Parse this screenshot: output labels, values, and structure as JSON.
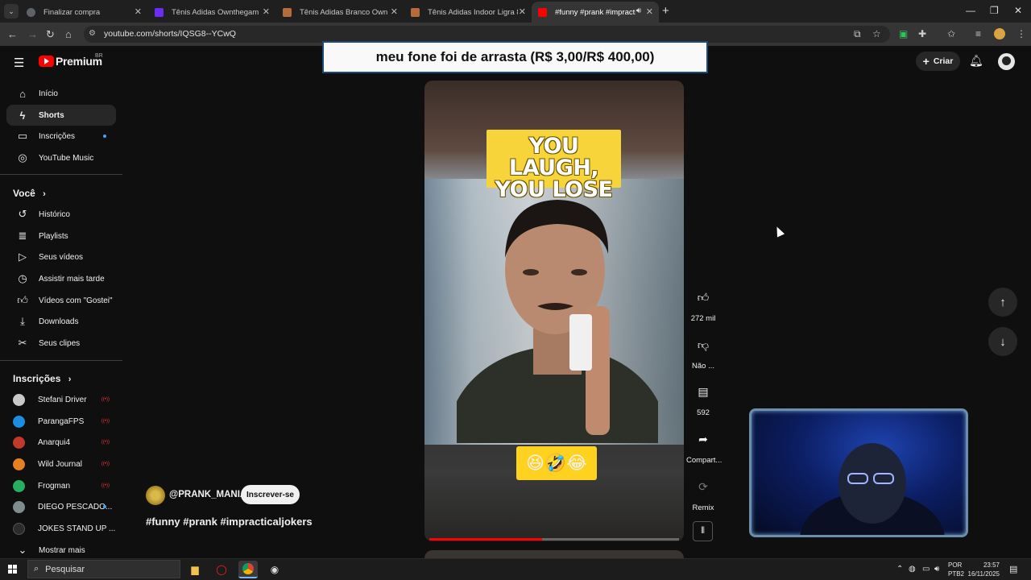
{
  "browser": {
    "tabs": [
      {
        "title": "Finalizar compra",
        "favicon_color": "#5f6368"
      },
      {
        "title": "Tênis Adidas Ownthegame 3.0 |",
        "favicon_color": "#6b2cf5"
      },
      {
        "title": "Tênis Adidas Branco Own the G",
        "favicon_color": "#b66b3c"
      },
      {
        "title": "Tênis Adidas Indoor Ligra 8 Ma",
        "favicon_color": "#b66b3c"
      },
      {
        "title": "#funny #prank #impractical",
        "favicon_color": "#ff0000"
      }
    ],
    "url": "youtube.com/shorts/IQSG8--YCwQ"
  },
  "youtube": {
    "logo_text": "Premium",
    "region": "BR",
    "create_label": "Criar",
    "sidebar": {
      "main": [
        {
          "label": "Início",
          "icon": "home-icon"
        },
        {
          "label": "Shorts",
          "icon": "shorts-icon"
        },
        {
          "label": "Inscrições",
          "icon": "subscriptions-icon"
        },
        {
          "label": "YouTube Music",
          "icon": "music-icon"
        }
      ],
      "you_heading": "Você",
      "you": [
        {
          "label": "Histórico",
          "icon": "history-icon"
        },
        {
          "label": "Playlists",
          "icon": "playlists-icon"
        },
        {
          "label": "Seus vídeos",
          "icon": "your-videos-icon"
        },
        {
          "label": "Assistir mais tarde",
          "icon": "watch-later-icon"
        },
        {
          "label": "Vídeos com \"Gostei\"",
          "icon": "liked-icon"
        },
        {
          "label": "Downloads",
          "icon": "download-icon"
        },
        {
          "label": "Seus clipes",
          "icon": "clips-icon"
        }
      ],
      "subs_heading": "Inscrições",
      "subscriptions": [
        {
          "label": "Stefani Driver",
          "color": "#c9c9c9",
          "status": "live"
        },
        {
          "label": "ParangaFPS",
          "color": "#1b8ee0",
          "status": "live"
        },
        {
          "label": "Anarqui4",
          "color": "#c0392b",
          "status": "live"
        },
        {
          "label": "Wild Journal",
          "color": "#e67e22",
          "status": "live"
        },
        {
          "label": "Frogman",
          "color": "#27ae60",
          "status": "live"
        },
        {
          "label": "DIEGO PESCADO...",
          "color": "#7f8c8d",
          "status": "new"
        },
        {
          "label": "JOKES STAND UP ...",
          "color": "#2c2c2c",
          "status": ""
        }
      ],
      "show_more": "Mostrar mais"
    },
    "short": {
      "overlay_title": "meu fone foi de arrasta (R$ 3,00/R$ 400,00)",
      "caption_line1": "YOU LAUGH,",
      "caption_line2": "YOU LOSE",
      "emojis": "😆🤣😂",
      "progress_fraction": 0.45,
      "channel": "@PRANK_MANIA",
      "subscribe_label": "Inscrever-se",
      "hashtags": "#funny #prank #impracticaljokers",
      "actions": {
        "like_count": "272 mil",
        "dislike_label": "Não ...",
        "comments_count": "592",
        "share_label": "Compart...",
        "remix_label": "Remix"
      }
    }
  },
  "taskbar": {
    "search_placeholder": "Pesquisar",
    "lang_line1": "POR",
    "lang_line2": "PTB2",
    "time": "23:57",
    "date": "16/11/2025"
  }
}
